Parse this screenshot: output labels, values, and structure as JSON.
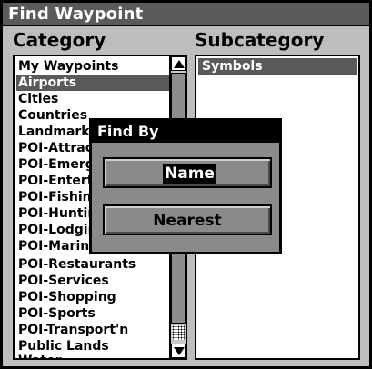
{
  "window": {
    "title": "Find Waypoint"
  },
  "category": {
    "heading": "Category",
    "items": [
      "My Waypoints",
      "Airports",
      "Cities",
      "Countries",
      "Landmarks",
      "POI-Attractions",
      "POI-Emergency",
      "POI-Entertainment",
      "POI-Fishing",
      "POI-Hunting",
      "POI-Lodging",
      "POI-Marinas",
      "POI-Restaurants",
      "POI-Services",
      "POI-Shopping",
      "POI-Sports",
      "POI-Transport'n",
      "Public Lands",
      "Water"
    ],
    "selected_index": 1
  },
  "subcategory": {
    "heading": "Subcategory",
    "items": [
      "Symbols"
    ]
  },
  "dialog": {
    "title": "Find By",
    "buttons": {
      "name": "Name",
      "nearest": "Nearest"
    }
  },
  "colors": {
    "frame": "#bdbdbd",
    "selection": "#5a5a5a",
    "dialog": "#8a8a8a"
  }
}
